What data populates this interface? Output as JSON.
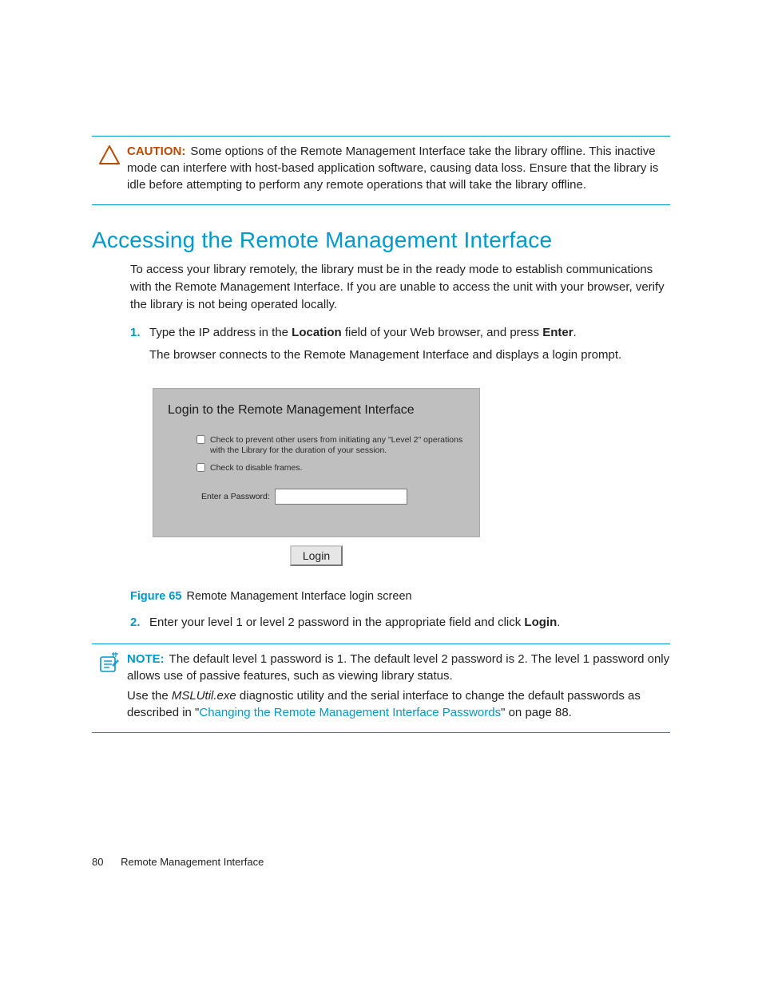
{
  "caution": {
    "label": "CAUTION:",
    "text": "Some options of the Remote Management Interface take the library offline. This inactive mode can interfere with host-based application software, causing data loss. Ensure that the library is idle before attempting to perform any remote operations that will take the library offline."
  },
  "section_title": "Accessing the Remote Management Interface",
  "intro": "To access your library remotely, the library must be in the ready mode to establish communications with the Remote Management Interface. If you are unable to access the unit with your browser, verify the library is not being operated locally.",
  "step1": {
    "num": "1.",
    "pre": "Type the IP address in the ",
    "bold1": "Location",
    "mid": " field of your Web browser, and press ",
    "bold2": "Enter",
    "post": ".",
    "sub": "The browser connects to the Remote Management Interface and displays a login prompt."
  },
  "login_panel": {
    "title": "Login to the Remote Management Interface",
    "check1": "Check to prevent other users from initiating any \"Level 2\" operations with the Library for the duration of your session.",
    "check2": "Check to disable frames.",
    "pass_label": "Enter a Password:",
    "button": "Login"
  },
  "figure": {
    "label": "Figure 65",
    "caption": "Remote Management Interface login screen"
  },
  "step2": {
    "num": "2.",
    "pre": "Enter your level 1 or level 2 password in the appropriate field and click ",
    "bold": "Login",
    "post": "."
  },
  "note": {
    "label": "NOTE:",
    "line1": "The default level 1 password is 1. The default level 2 password is 2. The level 1 password only allows use of passive features, such as viewing library status.",
    "line2_pre": "Use the ",
    "line2_file": "MSLUtil.exe",
    "line2_mid": " diagnostic utility and the serial interface to change the default passwords as described in \"",
    "line2_link": "Changing the Remote Management Interface Passwords",
    "line2_post": "\" on page 88."
  },
  "footer": {
    "page": "80",
    "title": "Remote Management Interface"
  }
}
